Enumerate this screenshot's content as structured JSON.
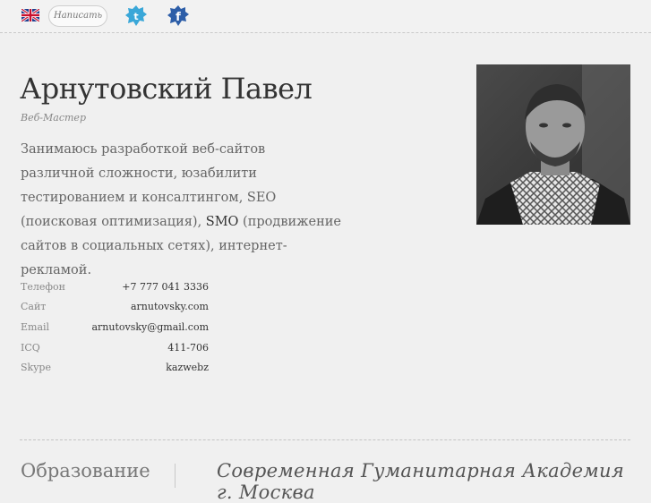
{
  "header": {
    "language_icon": "uk-flag-icon",
    "write_button": "Написать",
    "twitter_icon": "twitter-icon",
    "facebook_icon": "facebook-icon"
  },
  "profile": {
    "name": "Арнутовский Павел",
    "role": "Веб-Мастер",
    "description_part1": "Занимаюсь разработкой веб-сайтов различной сложности, юзабилити тестированием и консалтингом, SEO (поисковая оптимизация), ",
    "description_highlight": "SMO",
    "description_part2": " (продвижение сайтов в социальных сетях), интернет-рекламой."
  },
  "contacts": [
    {
      "label": "Телефон",
      "value": "+7 777 041 3336"
    },
    {
      "label": "Сайт",
      "value": "arnutovsky.com"
    },
    {
      "label": "Email",
      "value": "arnutovsky@gmail.com"
    },
    {
      "label": "ICQ",
      "value": "411-706"
    },
    {
      "label": "Skype",
      "value": "kazwebz"
    }
  ],
  "education": {
    "section_title": "Образование",
    "institution": "Современная Гуманитарная Академия г. Москва"
  },
  "colors": {
    "background": "#f0f0f0",
    "text": "#444444",
    "twitter": "#3aa7d8",
    "facebook": "#2d5ea8"
  }
}
